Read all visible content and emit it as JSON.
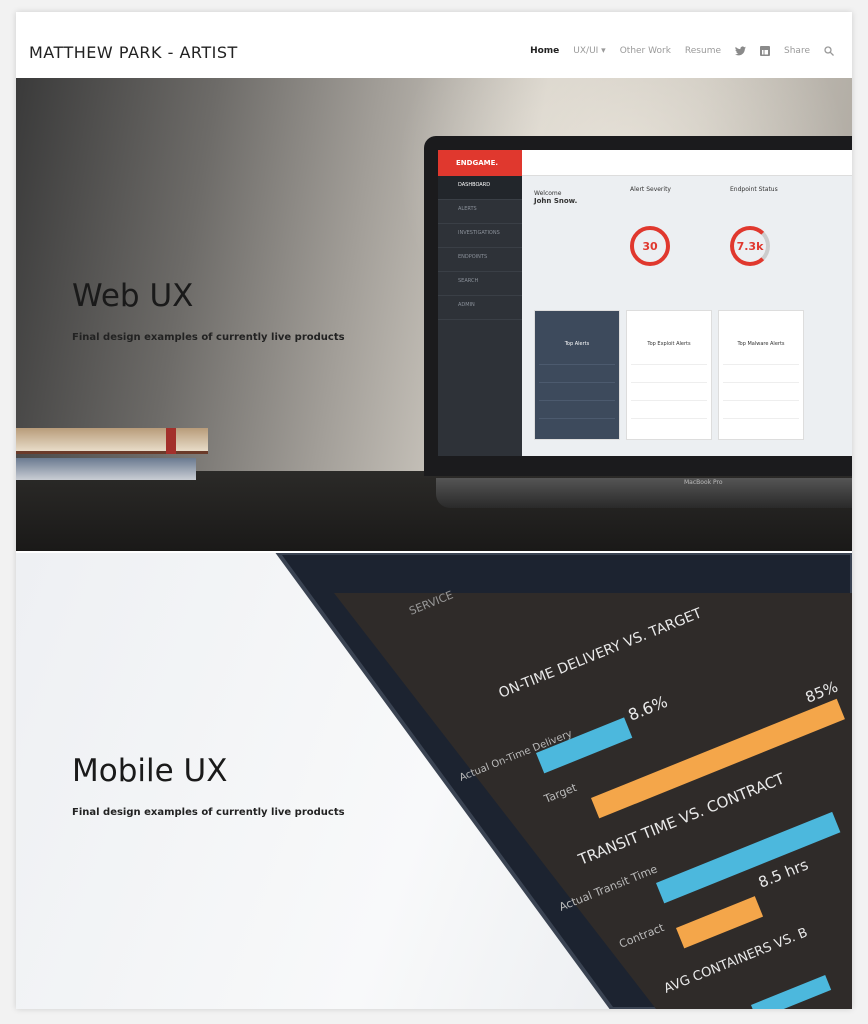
{
  "header": {
    "brand": "MATTHEW PARK - ARTIST",
    "nav": [
      {
        "label": "Home"
      },
      {
        "label": "UX/UI ▾"
      },
      {
        "label": "Other Work"
      },
      {
        "label": "Resume"
      },
      {
        "label": "Share"
      }
    ]
  },
  "sections": [
    {
      "title": "Web UX",
      "subtitle": "Final design examples of currently live products",
      "mock": {
        "logo": "ENDGAME.",
        "device": "MacBook Pro",
        "welcome": "Welcome",
        "user": "John Snow.",
        "sidebar": [
          "DASHBOARD",
          "ALERTS",
          "INVESTIGATIONS",
          "ENDPOINTS",
          "SEARCH",
          "ADMIN"
        ],
        "kpis": [
          {
            "label": "Alert Severity",
            "value": "30"
          },
          {
            "label": "Endpoint Status",
            "value": "7.3k"
          }
        ],
        "cards": [
          "Top Alerts",
          "Top Exploit Alerts",
          "Top Malware Alerts"
        ]
      }
    },
    {
      "title": "Mobile UX",
      "subtitle": "Final design examples of currently live products",
      "mock": {
        "status": "SERVICE",
        "chart1": "ON-TIME DELIVERY VS. TARGET",
        "actual1": "Actual On-Time Delivery",
        "target": "Target",
        "v1": "8.6%",
        "v2": "85%",
        "chart2": "TRANSIT TIME VS. CONTRACT",
        "actual2": "Actual Transit Time",
        "contract": "Contract",
        "v3": "8.5 hrs",
        "chart3": "AVG CONTAINERS VS. B"
      }
    }
  ]
}
